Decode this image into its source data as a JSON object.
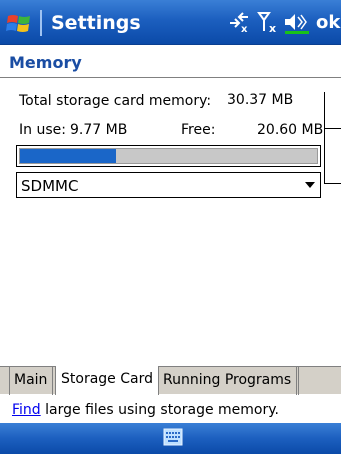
{
  "titlebar": {
    "title": "Settings",
    "ok_label": "ok",
    "icons": [
      "windows-start-icon",
      "connectivity-icon",
      "signal-icon",
      "volume-icon"
    ]
  },
  "page": {
    "heading": "Memory"
  },
  "storage": {
    "total_label": "Total storage card memory:",
    "total_value": "30.37 MB",
    "in_use_label": "In use:",
    "in_use_value": "9.77 MB",
    "free_label": "Free:",
    "free_value": "20.60 MB",
    "usage_fraction": 0.322
  },
  "dropdown": {
    "selected": "SDMMC"
  },
  "tabs": [
    {
      "label": "Main",
      "active": false
    },
    {
      "label": "Storage Card",
      "active": true
    },
    {
      "label": "Running Programs",
      "active": false
    }
  ],
  "find": {
    "link_text": "Find",
    "rest_text": " large files using storage memory."
  },
  "colors": {
    "titlebar": "#1c5fbf",
    "progress_fill": "#1a66c8",
    "heading": "#1a4da3",
    "link": "#0000ee"
  }
}
